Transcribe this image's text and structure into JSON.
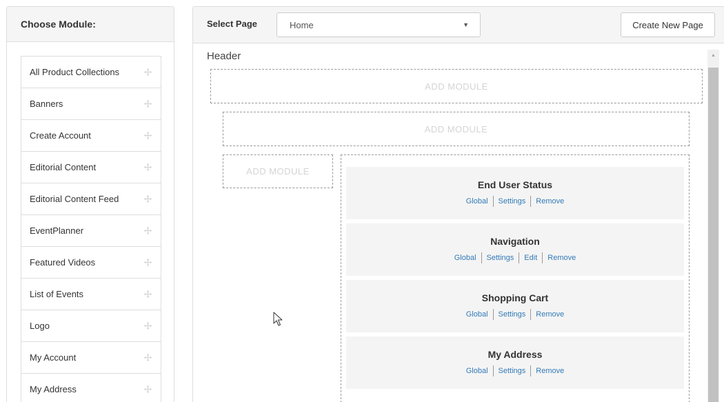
{
  "left_panel": {
    "title": "Choose Module:",
    "modules": [
      {
        "label": "All Product Collections",
        "icon": "move-icon"
      },
      {
        "label": "Banners",
        "icon": "move-icon"
      },
      {
        "label": "Create Account",
        "icon": "move-icon"
      },
      {
        "label": "Editorial Content",
        "icon": "move-icon"
      },
      {
        "label": "Editorial Content Feed",
        "icon": "move-icon"
      },
      {
        "label": "EventPlanner",
        "icon": "move-icon"
      },
      {
        "label": "Featured Videos",
        "icon": "move-icon"
      },
      {
        "label": "List of Events",
        "icon": "move-icon"
      },
      {
        "label": "Logo",
        "icon": "move-icon"
      },
      {
        "label": "My Account",
        "icon": "move-icon"
      },
      {
        "label": "My Address",
        "icon": "move-icon"
      }
    ]
  },
  "toolbar": {
    "select_label": "Select Page",
    "selected_page": "Home",
    "caret": "▼",
    "create_button": "Create New Page"
  },
  "layout": {
    "region_title": "Header",
    "add_module_label": "ADD MODULE",
    "placed_modules": [
      {
        "title": "End User Status",
        "actions": [
          "Global",
          "Settings",
          "Remove"
        ]
      },
      {
        "title": "Navigation",
        "actions": [
          "Global",
          "Settings",
          "Edit",
          "Remove"
        ]
      },
      {
        "title": "Shopping Cart",
        "actions": [
          "Global",
          "Settings",
          "Remove"
        ]
      },
      {
        "title": "My Address",
        "actions": [
          "Global",
          "Settings",
          "Remove"
        ]
      }
    ]
  },
  "scrollbar": {
    "up_arrow": "▲"
  },
  "colors": {
    "link": "#337ab7",
    "panel_header": "#f5f5f5",
    "border": "#dddddd",
    "placeholder_text": "#d4d4d4"
  }
}
